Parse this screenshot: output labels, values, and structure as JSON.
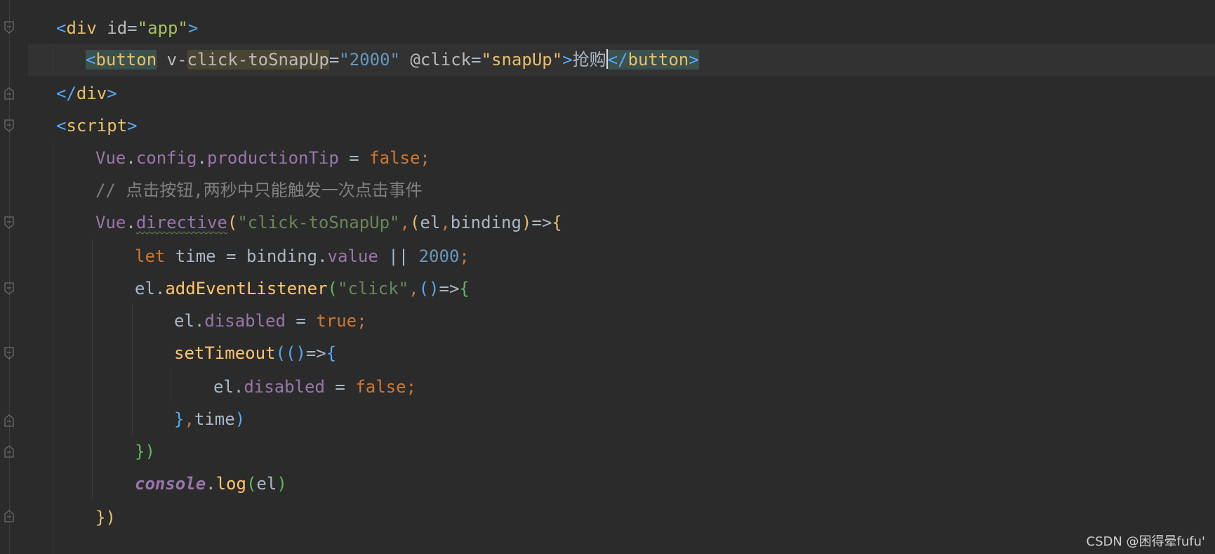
{
  "editor": {
    "lines": [
      {
        "id": "l1",
        "tokens": [
          {
            "t": "<",
            "c": "br-tag"
          },
          {
            "t": "div",
            "c": "tag"
          },
          {
            "t": " ",
            "c": "plain"
          },
          {
            "t": "id",
            "c": "attr"
          },
          {
            "t": "=",
            "c": "plain"
          },
          {
            "t": "\"app\"",
            "c": "str2"
          },
          {
            "t": ">",
            "c": "br-tag"
          }
        ]
      },
      {
        "id": "l2",
        "tokens": [
          {
            "t": "<",
            "c": "br-tag hl-tag"
          },
          {
            "t": "button",
            "c": "tag hl-tag"
          },
          {
            "t": " ",
            "c": "plain"
          },
          {
            "t": "v-",
            "c": "attr"
          },
          {
            "t": "click-toSnapUp",
            "c": "attr hl-word"
          },
          {
            "t": "=",
            "c": "plain"
          },
          {
            "t": "\"2000\"",
            "c": "num"
          },
          {
            "t": " ",
            "c": "plain"
          },
          {
            "t": "@click",
            "c": "attr"
          },
          {
            "t": "=",
            "c": "plain"
          },
          {
            "t": "\"snapUp\"",
            "c": "strgold"
          },
          {
            "t": ">",
            "c": "br-tag"
          },
          {
            "t": "抢购",
            "c": "plain"
          },
          {
            "t": "|caret|",
            "c": "caret"
          },
          {
            "t": "</",
            "c": "br-tag hl-tag"
          },
          {
            "t": "button",
            "c": "tag hl-tag"
          },
          {
            "t": ">",
            "c": "br-tag hl-tag"
          }
        ]
      },
      {
        "id": "l3",
        "tokens": [
          {
            "t": "</",
            "c": "br-tag"
          },
          {
            "t": "div",
            "c": "tag"
          },
          {
            "t": ">",
            "c": "br-tag"
          }
        ]
      },
      {
        "id": "l4",
        "tokens": [
          {
            "t": "<",
            "c": "br-tag"
          },
          {
            "t": "script",
            "c": "tag"
          },
          {
            "t": ">",
            "c": "br-tag"
          }
        ]
      },
      {
        "id": "l5",
        "tokens": [
          {
            "t": "Vue",
            "c": "vue"
          },
          {
            "t": ".",
            "c": "plain"
          },
          {
            "t": "config",
            "c": "prop"
          },
          {
            "t": ".",
            "c": "plain"
          },
          {
            "t": "productionTip",
            "c": "prop"
          },
          {
            "t": " = ",
            "c": "plain"
          },
          {
            "t": "false",
            "c": "kw"
          },
          {
            "t": ";",
            "c": "kw"
          }
        ]
      },
      {
        "id": "l6",
        "tokens": [
          {
            "t": "// 点击按钮,两秒中只能触发一次点击事件",
            "c": "cmt"
          }
        ]
      },
      {
        "id": "l7",
        "tokens": [
          {
            "t": "Vue",
            "c": "vue"
          },
          {
            "t": ".",
            "c": "plain"
          },
          {
            "t": "directive",
            "c": "prop underline-typo"
          },
          {
            "t": "(",
            "c": "paren1"
          },
          {
            "t": "\"click-toSnapUp\"",
            "c": "str"
          },
          {
            "t": ",",
            "c": "kw"
          },
          {
            "t": "(",
            "c": "paren1"
          },
          {
            "t": "el",
            "c": "plain"
          },
          {
            "t": ",",
            "c": "kw"
          },
          {
            "t": "binding",
            "c": "plain"
          },
          {
            "t": ")",
            "c": "paren1"
          },
          {
            "t": "=>",
            "c": "plain"
          },
          {
            "t": "{",
            "c": "paren1"
          }
        ]
      },
      {
        "id": "l8",
        "tokens": [
          {
            "t": "let",
            "c": "kw"
          },
          {
            "t": " time = binding.",
            "c": "plain"
          },
          {
            "t": "value",
            "c": "prop"
          },
          {
            "t": " || ",
            "c": "plain"
          },
          {
            "t": "2000",
            "c": "num"
          },
          {
            "t": ";",
            "c": "kw"
          }
        ]
      },
      {
        "id": "l9",
        "tokens": [
          {
            "t": "el.",
            "c": "plain"
          },
          {
            "t": "addEventListener",
            "c": "fn"
          },
          {
            "t": "(",
            "c": "paren3"
          },
          {
            "t": "\"click\"",
            "c": "str"
          },
          {
            "t": ",",
            "c": "kw"
          },
          {
            "t": "()",
            "c": "paren2"
          },
          {
            "t": "=>",
            "c": "plain"
          },
          {
            "t": "{",
            "c": "paren3"
          }
        ]
      },
      {
        "id": "l10",
        "tokens": [
          {
            "t": "el.",
            "c": "plain"
          },
          {
            "t": "disabled",
            "c": "prop"
          },
          {
            "t": " = ",
            "c": "plain"
          },
          {
            "t": "true",
            "c": "kw"
          },
          {
            "t": ";",
            "c": "kw"
          }
        ]
      },
      {
        "id": "l11",
        "tokens": [
          {
            "t": "setTimeout",
            "c": "fn"
          },
          {
            "t": "(",
            "c": "paren2"
          },
          {
            "t": "()",
            "c": "paren2"
          },
          {
            "t": "=>",
            "c": "plain"
          },
          {
            "t": "{",
            "c": "paren2"
          }
        ]
      },
      {
        "id": "l12",
        "tokens": [
          {
            "t": "el.",
            "c": "plain"
          },
          {
            "t": "disabled",
            "c": "prop"
          },
          {
            "t": " = ",
            "c": "plain"
          },
          {
            "t": "false",
            "c": "kw"
          },
          {
            "t": ";",
            "c": "kw"
          }
        ]
      },
      {
        "id": "l13",
        "tokens": [
          {
            "t": "}",
            "c": "paren2"
          },
          {
            "t": ",",
            "c": "kw"
          },
          {
            "t": "time",
            "c": "plain"
          },
          {
            "t": ")",
            "c": "paren2"
          }
        ]
      },
      {
        "id": "l14",
        "tokens": [
          {
            "t": "})",
            "c": "paren3"
          }
        ]
      },
      {
        "id": "l15",
        "tokens": [
          {
            "t": "console",
            "c": "italic-bold"
          },
          {
            "t": ".",
            "c": "plain"
          },
          {
            "t": "log",
            "c": "fn"
          },
          {
            "t": "(",
            "c": "paren3"
          },
          {
            "t": "el",
            "c": "plain"
          },
          {
            "t": ")",
            "c": "paren3"
          }
        ]
      },
      {
        "id": "l16",
        "tokens": [
          {
            "t": "})",
            "c": "paren1"
          }
        ]
      }
    ]
  },
  "watermark": {
    "text": "CSDN @困得晕fufu'"
  }
}
